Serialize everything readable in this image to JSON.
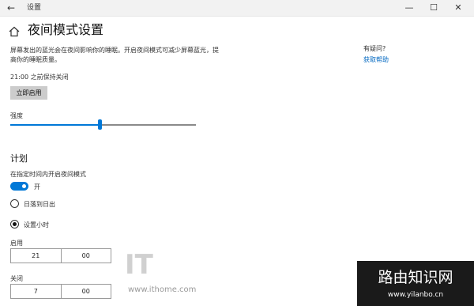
{
  "window": {
    "title": "设置",
    "back_icon": "arrow-left-icon",
    "min_label": "—",
    "max_label": "☐",
    "close_label": "✕"
  },
  "page": {
    "title": "夜间模式设置",
    "description": "屏幕发出的蓝光会在夜间影响你的睡眠。开启夜间模式可减少屏幕蓝光，提高你的睡眠质量。",
    "status": "21:00 之前保持关闭",
    "enable_button": "立即启用"
  },
  "strength": {
    "label": "强度",
    "value_percent": 48
  },
  "schedule": {
    "heading": "计划",
    "toggle_label": "在指定时间内开启夜间模式",
    "toggle_state": "开",
    "option_sunset": "日落到日出",
    "option_hours": "设置小时",
    "selected_option": "设置小时",
    "turn_on_label": "启用",
    "turn_on_hour": "21",
    "turn_on_minute": "00",
    "turn_off_label": "关闭",
    "turn_off_hour": "7",
    "turn_off_minute": "00"
  },
  "help": {
    "heading": "有疑问?",
    "link": "获取帮助"
  },
  "watermarks": {
    "ithome_logo": "IT",
    "ithome_url": "www.ithome.com",
    "site_title": "路由知识网",
    "site_url": "www.yilanbo.cn"
  },
  "colors": {
    "accent": "#0078d7",
    "link": "#0067c0",
    "button_bg": "#cccccc"
  }
}
